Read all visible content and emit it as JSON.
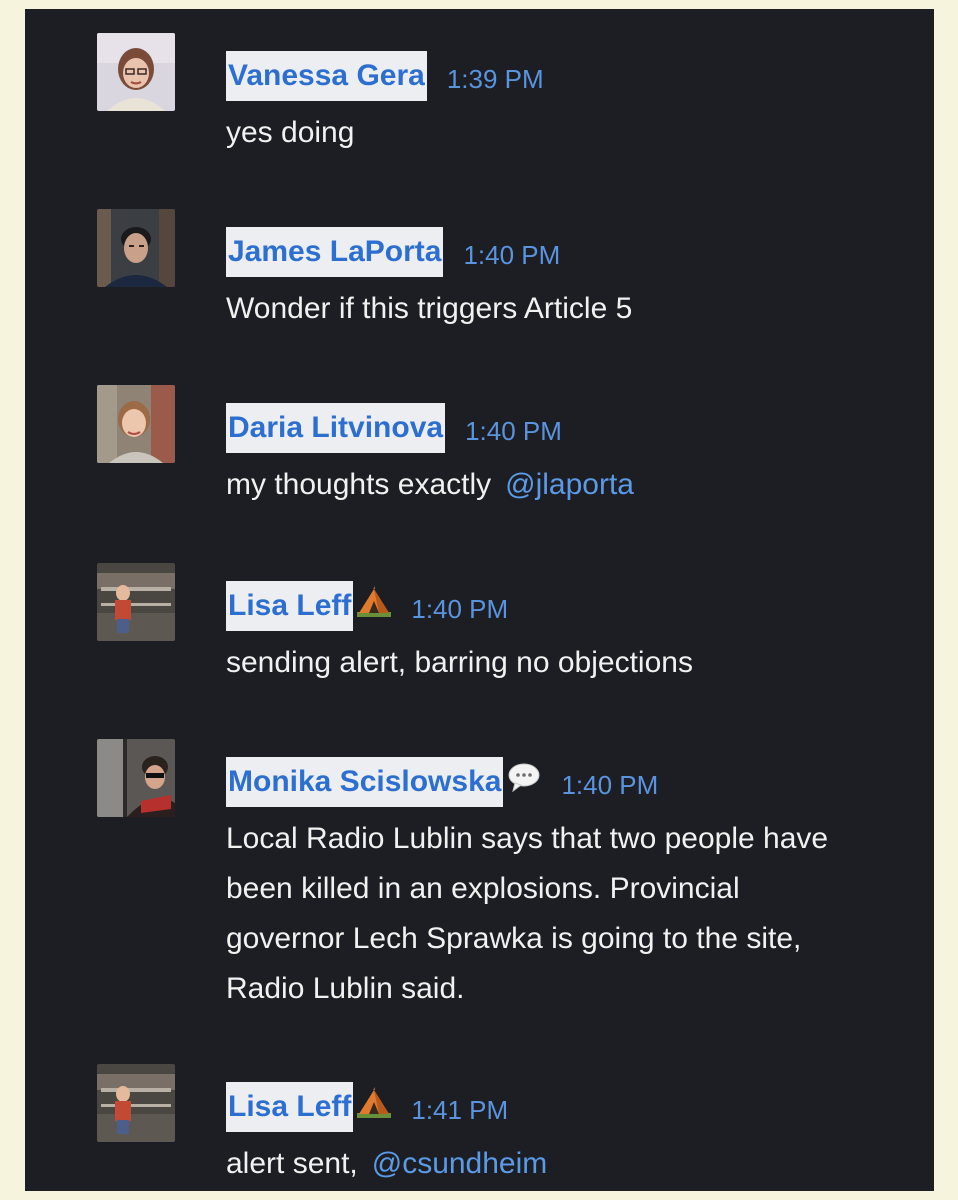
{
  "messages": [
    {
      "author": "Vanessa Gera",
      "time": "1:39 PM",
      "text": "yes doing",
      "mention": "",
      "avatar": "vanessa-avatar"
    },
    {
      "author": "James LaPorta",
      "time": "1:40 PM",
      "text": "Wonder if this triggers Article 5",
      "mention": "",
      "avatar": "james-avatar"
    },
    {
      "author": "Daria Litvinova",
      "time": "1:40 PM",
      "text": "my thoughts exactly",
      "mention": "@jlaporta",
      "avatar": "daria-avatar"
    },
    {
      "author": "Lisa Leff",
      "time": "1:40 PM",
      "text": "sending alert, barring no objections",
      "mention": "",
      "badge": "camping-tent-icon",
      "avatar": "lisa-avatar"
    },
    {
      "author": "Monika Scislowska",
      "time": "1:40 PM",
      "text": "Local Radio Lublin says that two people have been killed in an explosions. Provincial governor Lech Sprawka is going to the site, Radio Lublin said.",
      "mention": "",
      "badge": "speech-bubble-icon",
      "avatar": "monika-avatar"
    },
    {
      "author": "Lisa Leff",
      "time": "1:41 PM",
      "text": "alert sent,",
      "mention": "@csundheim",
      "badge": "camping-tent-icon",
      "avatar": "lisa-avatar"
    }
  ],
  "colors": {
    "background": "#1d1e23",
    "name_highlight": "#eceef1",
    "name_text": "#2d6fd1",
    "timestamp": "#5a93de",
    "mention": "#5b9ae6",
    "message_text": "#f1f1f1"
  }
}
